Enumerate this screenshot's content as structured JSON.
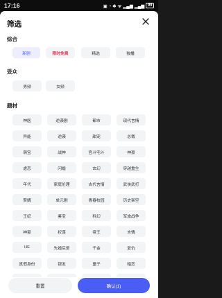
{
  "status_bar": {
    "time": "17:16",
    "icons": "▣ ◔ ✱ ᯤ ▂▄▆ ▂▄▆",
    "battery": "99"
  },
  "header": {
    "title": "筛选"
  },
  "sections": {
    "overall": {
      "label": "综合",
      "options": [
        {
          "label": "新剧",
          "state": "selected"
        },
        {
          "label": "限时免费",
          "state": "highlight"
        },
        {
          "label": "精选",
          "state": "normal"
        },
        {
          "label": "独播",
          "state": "normal"
        }
      ]
    },
    "audience": {
      "label": "受众",
      "options": [
        {
          "label": "男频"
        },
        {
          "label": "女频"
        }
      ]
    },
    "themes": {
      "label": "题材",
      "rows": [
        [
          "神医",
          "逆袭剧",
          "都市",
          "现代言情"
        ],
        [
          "异能",
          "逆袭",
          "甜宠",
          "总裁"
        ],
        [
          "萌宝",
          "战神",
          "官斗宅斗",
          "神豪"
        ],
        [
          "虐恋",
          "闪婚",
          "玄幻",
          "穿越重生"
        ],
        [
          "年代",
          "家庭伦理",
          "古代言情",
          "武侠武打"
        ],
        [
          "赘婿",
          "单元剧",
          "青春校园",
          "历史架空"
        ],
        [
          "王妃",
          "鉴宝",
          "科幻",
          "军旅战争"
        ],
        [
          "神豪",
          "权谋",
          "帝王",
          "言情"
        ],
        [
          "HE",
          "先婚后爱",
          "千金",
          "复仇"
        ],
        [
          "真假身份",
          "银发",
          "童子",
          "暗恋"
        ],
        [
          "",
          "",
          "",
          ""
        ]
      ]
    }
  },
  "footer": {
    "reset_label": "重置",
    "confirm_label": "确认(1)"
  }
}
